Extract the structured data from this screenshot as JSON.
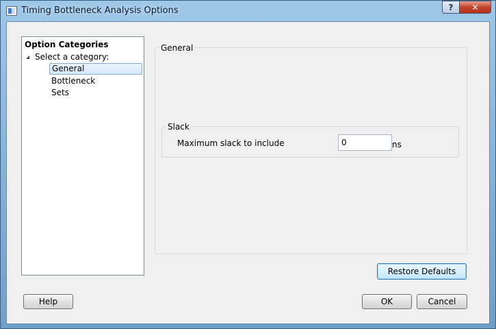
{
  "window": {
    "title": "Timing Bottleneck Analysis Options",
    "help_button": "?",
    "close_button": "✕"
  },
  "categories": {
    "header": "Option Categories",
    "root": "Select a category:",
    "items": [
      {
        "label": "General",
        "selected": true
      },
      {
        "label": "Bottleneck",
        "selected": false
      },
      {
        "label": "Sets",
        "selected": false
      }
    ]
  },
  "general": {
    "title": "General",
    "slack_group": {
      "title": "Slack",
      "label": "Maximum slack to include",
      "value": "0",
      "unit": "ns"
    }
  },
  "buttons": {
    "restore": "Restore Defaults",
    "help": "Help",
    "ok": "OK",
    "cancel": "Cancel"
  },
  "colors": {
    "selection_border": "#84acdd",
    "default_button_border": "#3c7fb1",
    "close_button": "#c1442e"
  }
}
